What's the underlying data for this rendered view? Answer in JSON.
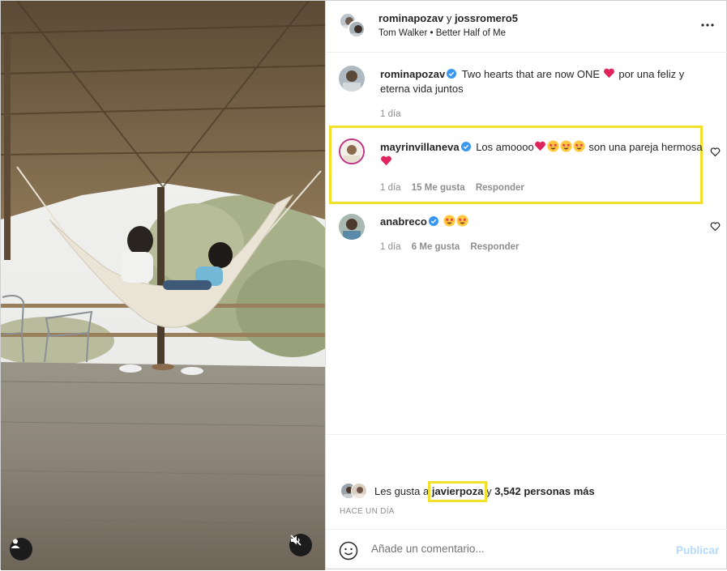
{
  "header": {
    "user1": "rominapozav",
    "conjunction": "y",
    "user2": "jossromero5",
    "song_artist": "Tom Walker",
    "song_separator": "•",
    "song_title": "Better Half of Me"
  },
  "caption": {
    "username": "rominapozav",
    "text_before": "Two hearts that are now ONE",
    "text_after": "por una feliz y eterna vida juntos",
    "time": "1 día"
  },
  "comments": [
    {
      "username": "mayrinvillaneva",
      "text_before": "Los amoooo",
      "text_after": "son una pareja hermosa",
      "time": "1 día",
      "likes": "15 Me gusta",
      "reply": "Responder",
      "emojis": [
        "red-heart",
        "star-eyes-face",
        "star-eyes-face",
        "star-eyes-face"
      ],
      "emojis_after": [
        "red-heart"
      ]
    },
    {
      "username": "anabreco",
      "time": "1 día",
      "likes": "6 Me gusta",
      "reply": "Responder",
      "emojis": [
        "star-eyes-face",
        "star-eyes-face"
      ]
    }
  ],
  "likes": {
    "prefix": "Les gusta a",
    "user": "javierpoza",
    "suffix_y": "y",
    "others": "3,542 personas más"
  },
  "date_label": "HACE UN DÍA",
  "add_comment": {
    "placeholder": "Añade un comentario...",
    "publish": "Publicar"
  },
  "colors": {
    "highlight": "#f2e02a",
    "verified": "#3897f0",
    "publish_disabled": "#b3dbff",
    "meta_grey": "#8e8e8e"
  },
  "icons": [
    "more-options-icon",
    "verified-badge-icon",
    "heart-outline-icon",
    "emoji-smile-icon",
    "user-tag-icon",
    "muted-speaker-icon"
  ]
}
